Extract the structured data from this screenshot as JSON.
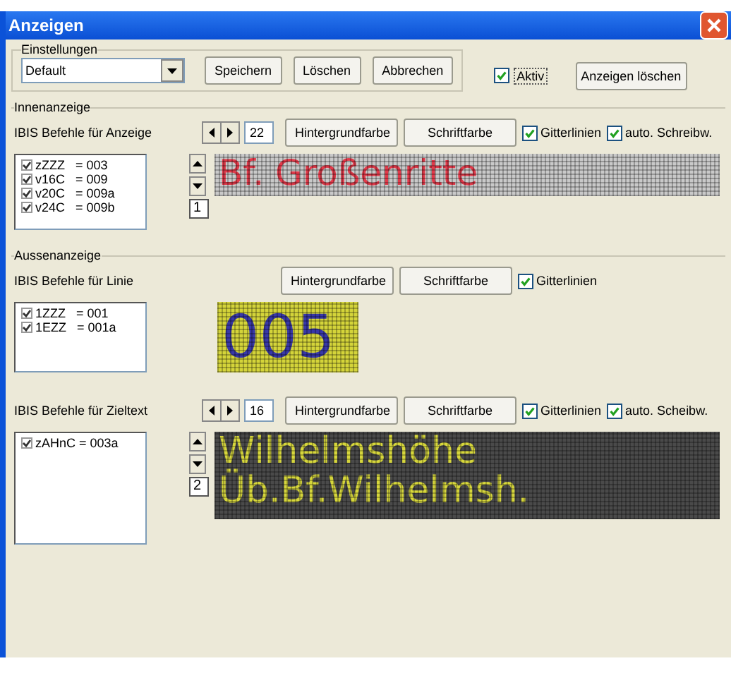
{
  "window": {
    "title": "Anzeigen"
  },
  "settings": {
    "legend": "Einstellungen",
    "preset": "Default",
    "buttons": [
      "Speichern",
      "Löschen",
      "Abbrechen"
    ],
    "active": {
      "label": "Aktiv",
      "checked": true
    },
    "clear_button": "Anzeigen löschen"
  },
  "sections": [
    {
      "legend": "Innenanzeige",
      "panels": [
        {
          "kind": "red_on_grey",
          "list_label": "IBIS Befehle für Anzeige",
          "size": "22",
          "line": "1",
          "buttons": [
            "Hintergrundfarbe",
            "Schriftfarbe"
          ],
          "options": [
            {
              "label": "Gitterlinien",
              "checked": true
            },
            {
              "label": "auto. Schreibw.",
              "checked": true
            }
          ],
          "commands": [
            {
              "text": "zZZZ   = 003",
              "checked": true
            },
            {
              "text": "v16C   = 009",
              "checked": true
            },
            {
              "text": "v20C   = 009a",
              "checked": true
            },
            {
              "text": "v24C   = 009b",
              "checked": true
            }
          ],
          "display_lines": [
            "Bf. Großenritte"
          ]
        }
      ]
    },
    {
      "legend": "Aussenanzeige",
      "panels": [
        {
          "kind": "blue_on_yellow",
          "list_label": "IBIS Befehle für Linie",
          "buttons": [
            "Hintergrundfarbe",
            "Schriftfarbe"
          ],
          "options": [
            {
              "label": "Gitterlinien",
              "checked": true
            }
          ],
          "commands": [
            {
              "text": "1ZZZ   = 001",
              "checked": true
            },
            {
              "text": "1EZZ   = 001a",
              "checked": true
            }
          ],
          "display_lines": [
            "005"
          ]
        },
        {
          "kind": "yellow_on_dark",
          "list_label": "IBIS Befehle für Zieltext",
          "size": "16",
          "line": "2",
          "buttons": [
            "Hintergrundfarbe",
            "Schriftfarbe"
          ],
          "options": [
            {
              "label": "Gitterlinien",
              "checked": true
            },
            {
              "label": "auto. Scheibw.",
              "checked": true
            }
          ],
          "commands": [
            {
              "text": "zAHnC = 003a",
              "checked": true
            }
          ],
          "display_lines": [
            "Wilhelmshöhe",
            "Üb.Bf.Wilhelmsh."
          ]
        }
      ]
    }
  ]
}
